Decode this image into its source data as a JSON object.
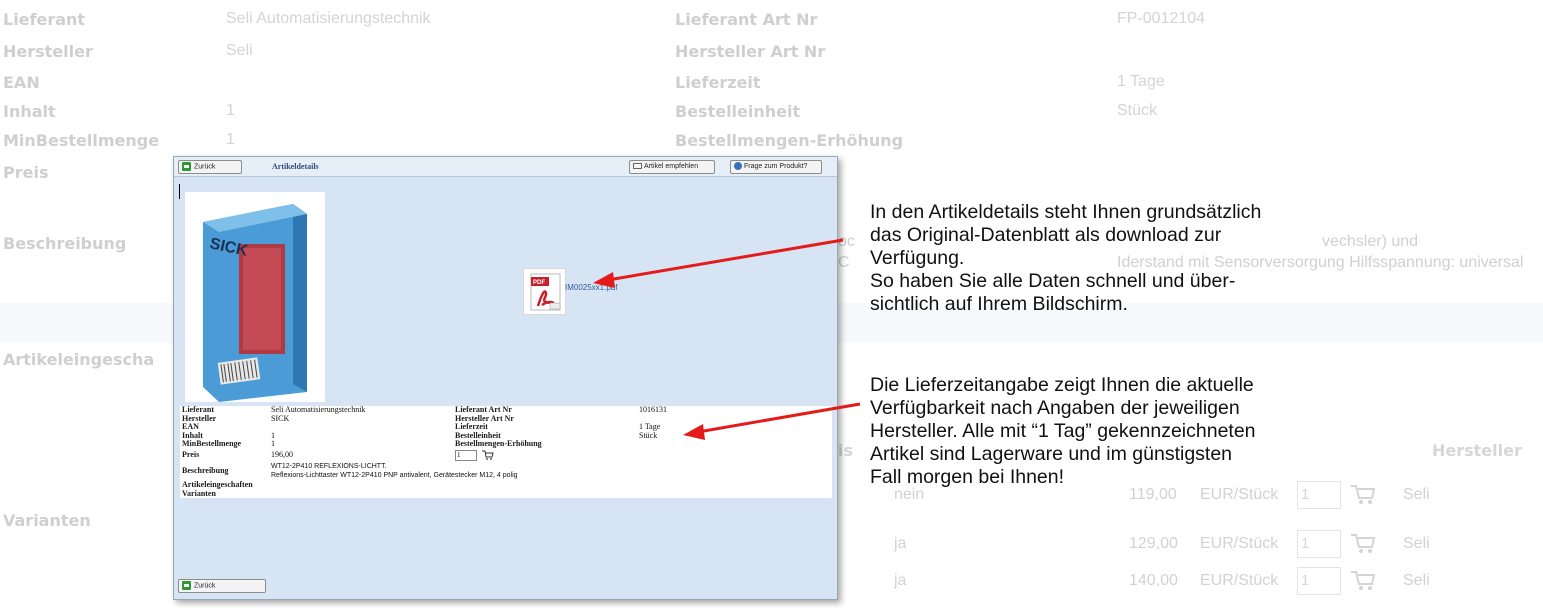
{
  "background": {
    "left_labels": [
      "Lieferant",
      "Hersteller",
      "EAN",
      "Inhalt",
      "MinBestellmenge",
      "Preis",
      "Beschreibung",
      "Artikeleingescha",
      "Varianten"
    ],
    "left_values": [
      "Seli Automatisierungstechnik",
      "Seli",
      "",
      "1",
      "1"
    ],
    "right_labels": [
      "Lieferant Art Nr",
      "Hersteller Art Nr",
      "Lieferzeit",
      "Bestelleinheit",
      "Bestellmengen-Erhöhung"
    ],
    "right_values": [
      "FP-0012104",
      "",
      "1 Tage",
      "Stück",
      ""
    ],
    "description_line1": "oc",
    "description_line1b": "vechsler) und",
    "description_line2": "C",
    "description_line2b": "Iderstand mit Sensorversorgung Hilfsspannung: universal",
    "variants_header_partial": "is",
    "variants_header_manufacturer": "Hersteller",
    "variant_rows": [
      {
        "avail": "nein",
        "price": "119,00",
        "unit": "EUR/Stück",
        "qty": "1",
        "manufacturer": "Seli"
      },
      {
        "avail": "ja",
        "price": "129,00",
        "unit": "EUR/Stück",
        "qty": "1",
        "manufacturer": "Seli"
      },
      {
        "avail": "ja",
        "price": "140,00",
        "unit": "EUR/Stück",
        "qty": "1",
        "manufacturer": "Seli"
      }
    ]
  },
  "window": {
    "back_top": "Zurück",
    "title": "Artikeldetails",
    "recommend": "Artikel empfehlen",
    "question": "Frage zum Produkt?",
    "pdf_file": "IM0025xx1.pdf",
    "brand": "SICK",
    "rows": [
      [
        "Lieferant",
        "Seli Automatisierungstechnik",
        "Lieferant Art Nr",
        "1016131"
      ],
      [
        "Hersteller",
        "SICK",
        "Hersteller Art Nr",
        ""
      ],
      [
        "EAN",
        "",
        "Lieferzeit",
        "1 Tage"
      ],
      [
        "Inhalt",
        "1",
        "Bestelleinheit",
        "Stück"
      ],
      [
        "MinBestellmenge",
        "1",
        "Bestellmengen-Erhöhung",
        ""
      ]
    ],
    "price_label": "Preis",
    "price_value": "196,00",
    "qty": "1",
    "desc_label": "Beschreibung",
    "desc_line1": "WT12-2P410 REFLEXIONS-LICHTT.",
    "desc_line2": "Reflexions-Lichttaster WT12-2P410 PNP antivalent, Gerätestecker M12, 4 polig",
    "features_label": "Artikeleingeschaften",
    "variants_label": "Varianten",
    "back_bottom": "Zurück"
  },
  "callouts": {
    "datasheet": [
      "In den Artikeldetails steht Ihnen grundsätzlich",
      "das Original-Datenblatt als download zur",
      "Verfügung.",
      "So haben Sie alle Daten schnell und über-",
      "sichtlich auf Ihrem Bildschirm."
    ],
    "delivery": [
      "Die Lieferzeitangabe zeigt Ihnen die aktuelle",
      "Verfügbarkeit nach Angaben der jeweiligen",
      "Hersteller. Alle mit “1 Tag” gekennzeichneten",
      "Artikel sind Lagerware und im günstigsten",
      "Fall morgen bei Ihnen!"
    ]
  },
  "colors": {
    "arrow": "#e31b1b",
    "window_bg": "#d6e4f3",
    "faded_text": "#d0d0d0"
  }
}
